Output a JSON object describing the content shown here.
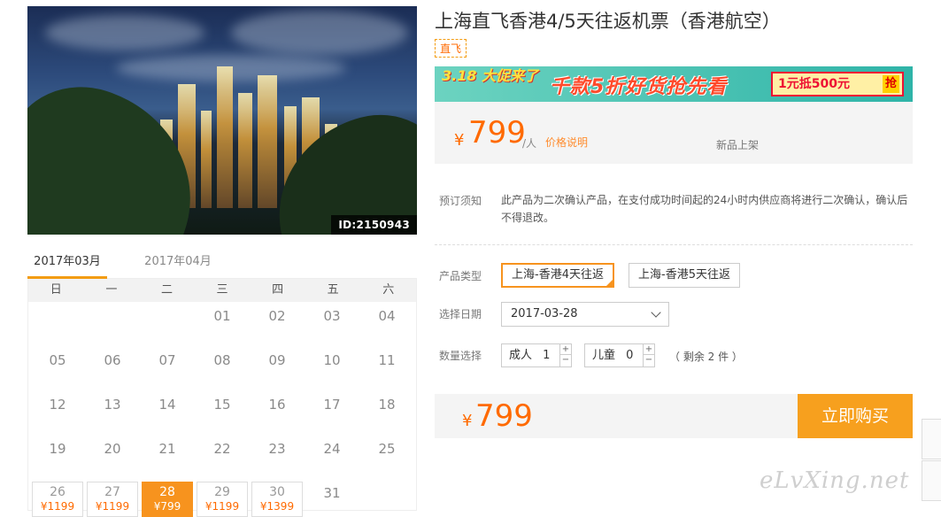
{
  "hero": {
    "image_id": "ID:2150943"
  },
  "calendar": {
    "months": [
      "2017年03月",
      "2017年04月"
    ],
    "active_month": 0,
    "weekdays": [
      "日",
      "一",
      "二",
      "三",
      "四",
      "五",
      "六"
    ],
    "rows": [
      [
        "",
        "",
        "",
        "01",
        "02",
        "03",
        "04"
      ],
      [
        "05",
        "06",
        "07",
        "08",
        "09",
        "10",
        "11"
      ],
      [
        "12",
        "13",
        "14",
        "15",
        "16",
        "17",
        "18"
      ],
      [
        "19",
        "20",
        "21",
        "22",
        "23",
        "24",
        "25"
      ]
    ],
    "bookable": [
      {
        "day": "26",
        "price": "¥1199"
      },
      {
        "day": "27",
        "price": "¥1199"
      },
      {
        "day": "28",
        "price": "¥799",
        "selected": true
      },
      {
        "day": "29",
        "price": "¥1199"
      },
      {
        "day": "30",
        "price": "¥1399"
      }
    ],
    "last_day": "31"
  },
  "product": {
    "title": "上海直飞香港4/5天往返机票（香港航空）",
    "tag": "直飞",
    "banner": {
      "left": "3.18 大促来了",
      "middle": "千款5折好货抢先看",
      "right": "1元抵500元",
      "right_btn": "抢"
    },
    "currency": "¥",
    "price": "799",
    "unit": "/人",
    "price_note": "价格说明",
    "status": "新品上架",
    "notice_label": "预订须知",
    "notice_text": "此产品为二次确认产品，在支付成功时间起的24小时内供应商将进行二次确认，确认后不得退改。"
  },
  "options": {
    "type_label": "产品类型",
    "types": [
      "上海-香港4天往返",
      "上海-香港5天往返"
    ],
    "selected_type": 0,
    "date_label": "选择日期",
    "date_value": "2017-03-28",
    "qty_label": "数量选择",
    "adult_label": "成人",
    "adult_value": "1",
    "child_label": "儿童",
    "child_value": "0",
    "remaining": "（ 剩余 2 件 ）"
  },
  "checkout": {
    "currency": "¥",
    "total": "799",
    "buy_label": "立即购买"
  },
  "watermark": "eLvXing.net"
}
